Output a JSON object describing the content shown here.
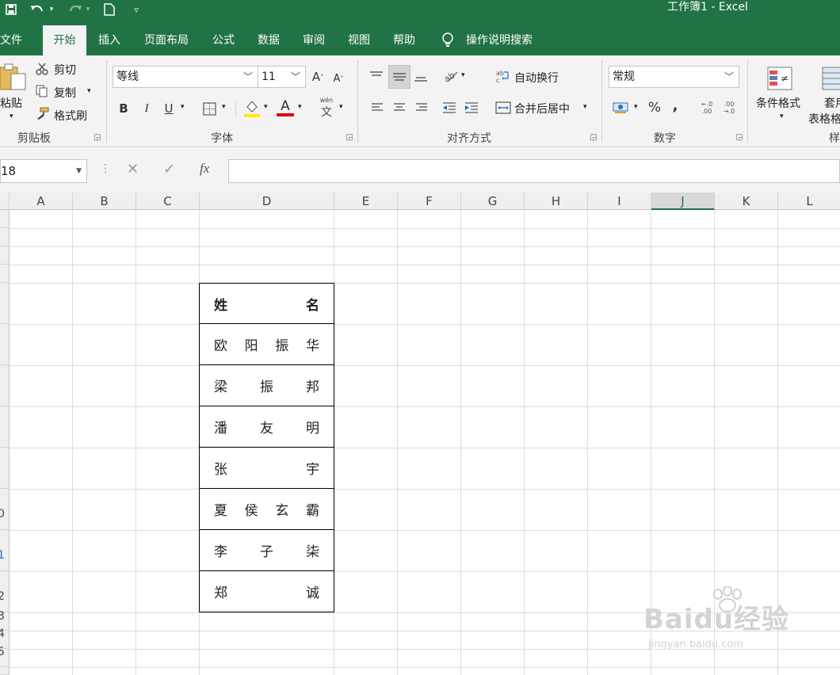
{
  "app": {
    "window_title": "工作簿1  -  Excel"
  },
  "tabs": [
    {
      "label": "文件"
    },
    {
      "label": "开始"
    },
    {
      "label": "插入"
    },
    {
      "label": "页面布局"
    },
    {
      "label": "公式"
    },
    {
      "label": "数据"
    },
    {
      "label": "审阅"
    },
    {
      "label": "视图"
    },
    {
      "label": "帮助"
    }
  ],
  "search": {
    "label": "操作说明搜索"
  },
  "clipboard": {
    "paste": "粘贴",
    "cut": "剪切",
    "copy": "复制",
    "format_painter": "格式刷",
    "group_label": "剪贴板"
  },
  "font": {
    "name": "等线",
    "size": "11",
    "bold": "B",
    "italic": "I",
    "underline": "U",
    "font_color_glyph": "A",
    "group_label": "字体"
  },
  "alignment": {
    "wrap_text": "自动换行",
    "merge_center": "合并后居中",
    "group_label": "对齐方式"
  },
  "number": {
    "format": "常规",
    "percent": "%",
    "comma": ",",
    "group_label": "数字"
  },
  "styles": {
    "conditional_formatting": "条件格式",
    "table_format_line1": "套用",
    "table_format_line2": "表格格",
    "group_label": "样"
  },
  "formula_bar": {
    "name_box": "18",
    "fx": "fx",
    "formula": ""
  },
  "columns": [
    "A",
    "B",
    "C",
    "D",
    "E",
    "F",
    "G",
    "H",
    "I",
    "J",
    "K",
    "L"
  ],
  "selected_column": "J",
  "row_numbers_visible": [
    "0",
    "1",
    "2",
    "3",
    "4",
    "5"
  ],
  "table": {
    "rows": [
      [
        "姓",
        "名"
      ],
      [
        "欧",
        "阳",
        "振",
        "华"
      ],
      [
        "梁",
        "振",
        "邦"
      ],
      [
        "潘",
        "友",
        "明"
      ],
      [
        "张",
        "宇"
      ],
      [
        "夏",
        "侯",
        "玄",
        "霸"
      ],
      [
        "李",
        "子",
        "柒"
      ],
      [
        "郑",
        "诚"
      ]
    ]
  },
  "watermark": {
    "logo": "Baidu经验",
    "url": "jingyan.baidu.com"
  },
  "colors": {
    "excel_green": "#217346",
    "ribbon_bg": "#f3f3f3"
  }
}
